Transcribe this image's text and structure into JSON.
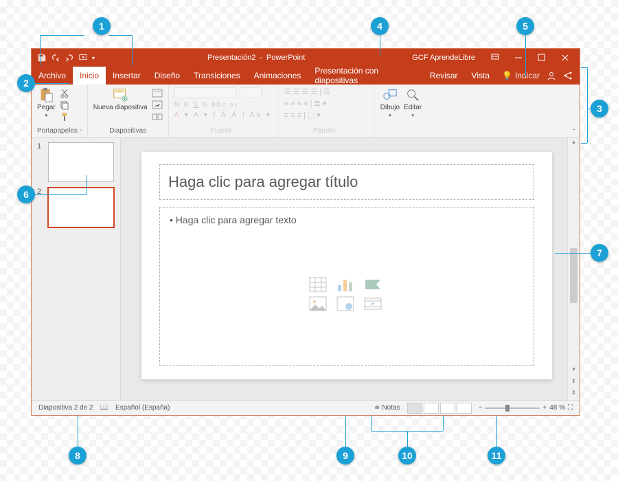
{
  "titlebar": {
    "doc_name": "Presentación2",
    "app_name": "PowerPoint",
    "account": "GCF AprendeLibre"
  },
  "tabs": {
    "file": "Archivo",
    "items": [
      "Inicio",
      "Insertar",
      "Diseño",
      "Transiciones",
      "Animaciones",
      "Presentación con diapositivas",
      "Revisar",
      "Vista"
    ],
    "active_index": 0,
    "tell_me": "Indicar"
  },
  "ribbon": {
    "groups": {
      "clipboard": {
        "label": "Portapapeles",
        "paste": "Pegar"
      },
      "slides": {
        "label": "Diapositivas",
        "new_slide": "Nueva diapositiva"
      },
      "font": {
        "label": "Fuente"
      },
      "paragraph": {
        "label": "Párrafo"
      },
      "drawing": {
        "label": "Dibujo",
        "btn": "Dibujo"
      },
      "editing": {
        "btn": "Editar"
      }
    }
  },
  "thumbnails": [
    {
      "num": "1",
      "selected": false
    },
    {
      "num": "2",
      "selected": true
    }
  ],
  "slide": {
    "title_placeholder": "Haga clic para agregar título",
    "body_placeholder": "• Haga clic para agregar texto"
  },
  "status": {
    "slide_counter": "Diapositiva 2 de 2",
    "language": "Español (España)",
    "notes": "Notas",
    "zoom_pct": "48 %"
  },
  "callouts": {
    "1": "1",
    "2": "2",
    "3": "3",
    "4": "4",
    "5": "5",
    "6": "6",
    "7": "7",
    "8": "8",
    "9": "9",
    "10": "10",
    "11": "11"
  }
}
